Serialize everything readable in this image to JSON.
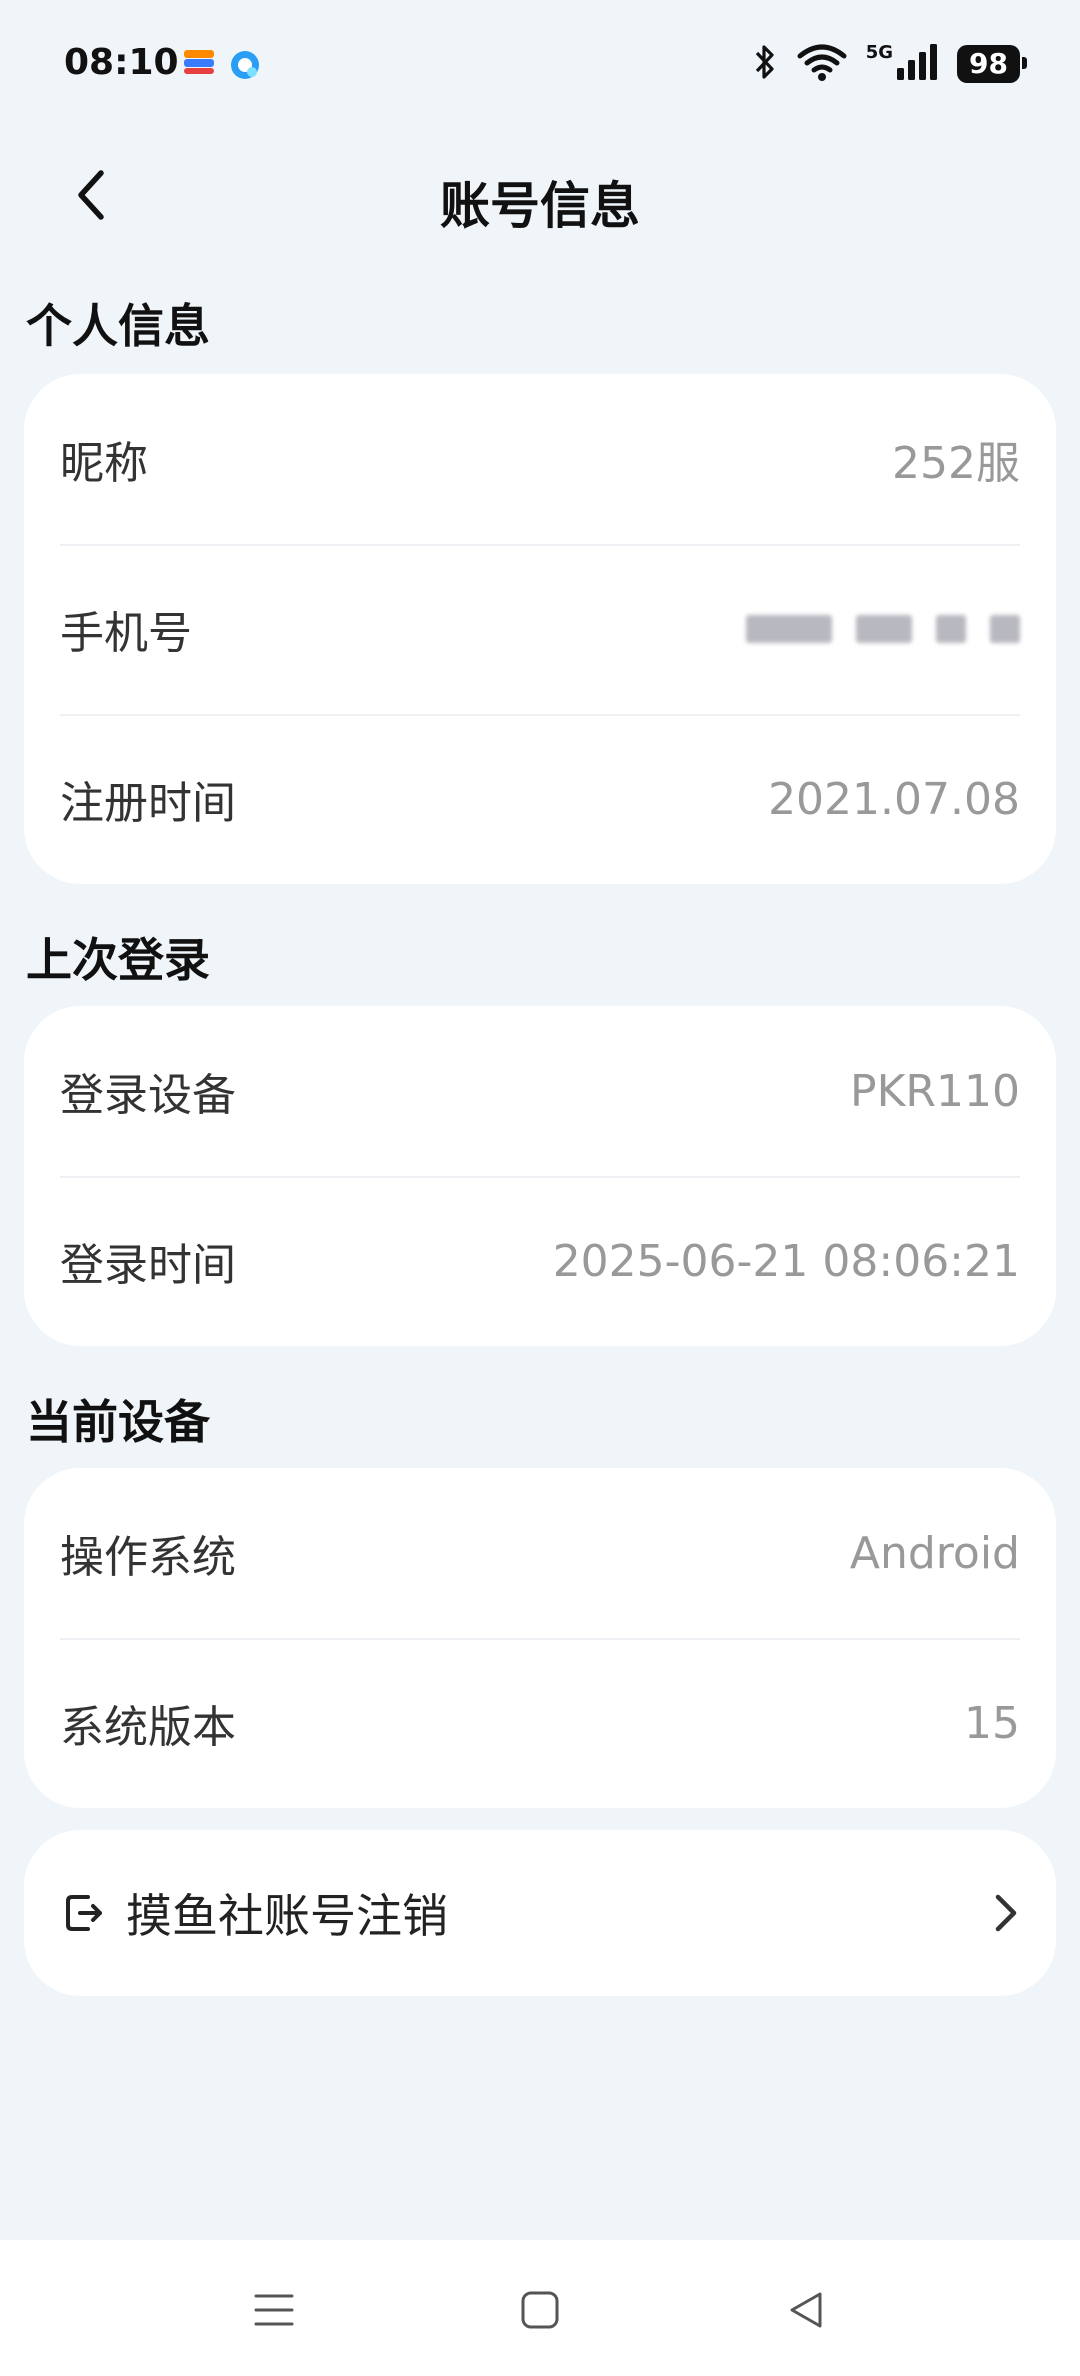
{
  "status_bar": {
    "time": "08:10",
    "network": "5G",
    "battery": "98"
  },
  "header": {
    "title": "账号信息"
  },
  "personal_info": {
    "title": "个人信息",
    "rows": [
      {
        "label": "昵称",
        "value": "252服"
      },
      {
        "label": "手机号",
        "value": ""
      },
      {
        "label": "注册时间",
        "value": "2021.07.08"
      }
    ]
  },
  "last_login": {
    "title": "上次登录",
    "rows": [
      {
        "label": "登录设备",
        "value": "PKR110"
      },
      {
        "label": "登录时间",
        "value": "2025-06-21 08:06:21"
      }
    ]
  },
  "current_device": {
    "title": "当前设备",
    "rows": [
      {
        "label": "操作系统",
        "value": "Android"
      },
      {
        "label": "系统版本",
        "value": "15"
      }
    ]
  },
  "account_cancel": {
    "label": "摸鱼社账号注销"
  },
  "icons": {
    "back": "chevron-left-icon",
    "logout": "logout-icon",
    "chevron": "chevron-right-icon",
    "menu": "menu-icon",
    "home": "home-square-icon",
    "nav_back": "triangle-back-icon"
  }
}
